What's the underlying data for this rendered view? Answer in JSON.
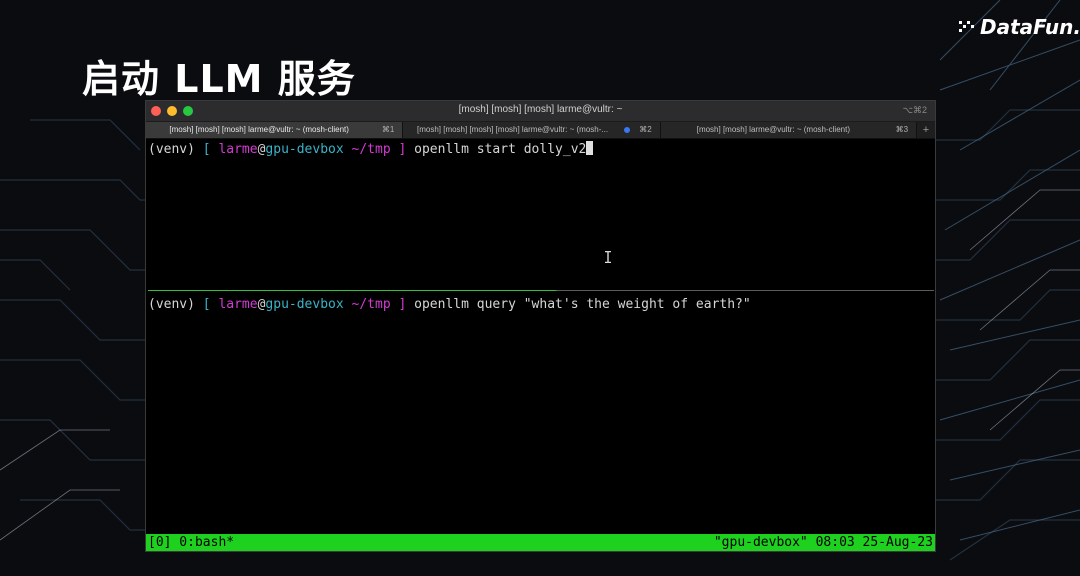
{
  "slide": {
    "title": "启动 LLM 服务",
    "logo_text": "DataFun."
  },
  "window": {
    "title": "[mosh] [mosh] [mosh] larme@vultr: ~",
    "shortcut": "⌥⌘2"
  },
  "tabs": [
    {
      "label": "[mosh] [mosh] [mosh] larme@vultr: ~ (mosh-client)",
      "key": "⌘1",
      "active": true
    },
    {
      "label": "[mosh] [mosh] [mosh] [mosh] larme@vultr: ~ (mosh-...",
      "key": "⌘2",
      "active": false,
      "indicator": "blue-dot"
    },
    {
      "label": "[mosh] [mosh] larme@vultr: ~ (mosh-client)",
      "key": "⌘3",
      "active": false
    }
  ],
  "tab_add": "+",
  "prompt": {
    "venv": "(venv) ",
    "open_bracket": "[ ",
    "user": "larme",
    "at": "@",
    "host": "gpu-devbox",
    "dir": " ~/tmp",
    "close_bracket": " ]"
  },
  "panes": {
    "top_command": " openllm start dolly_v2",
    "bottom_command": " openllm query \"what's the weight of earth?\""
  },
  "tmux": {
    "left": "[0] 0:bash*",
    "right": "\"gpu-devbox\" 08:03 25-Aug-23"
  },
  "icons": {
    "logo": "datafun-logo-icon",
    "mouse": "ibeam-cursor-icon",
    "close": "close-icon",
    "minimize": "minimize-icon",
    "zoom": "zoom-icon"
  },
  "colors": {
    "status_bar": "#1fd11f",
    "prompt_user": "#d33bd3",
    "prompt_host": "#3ab3c8"
  }
}
